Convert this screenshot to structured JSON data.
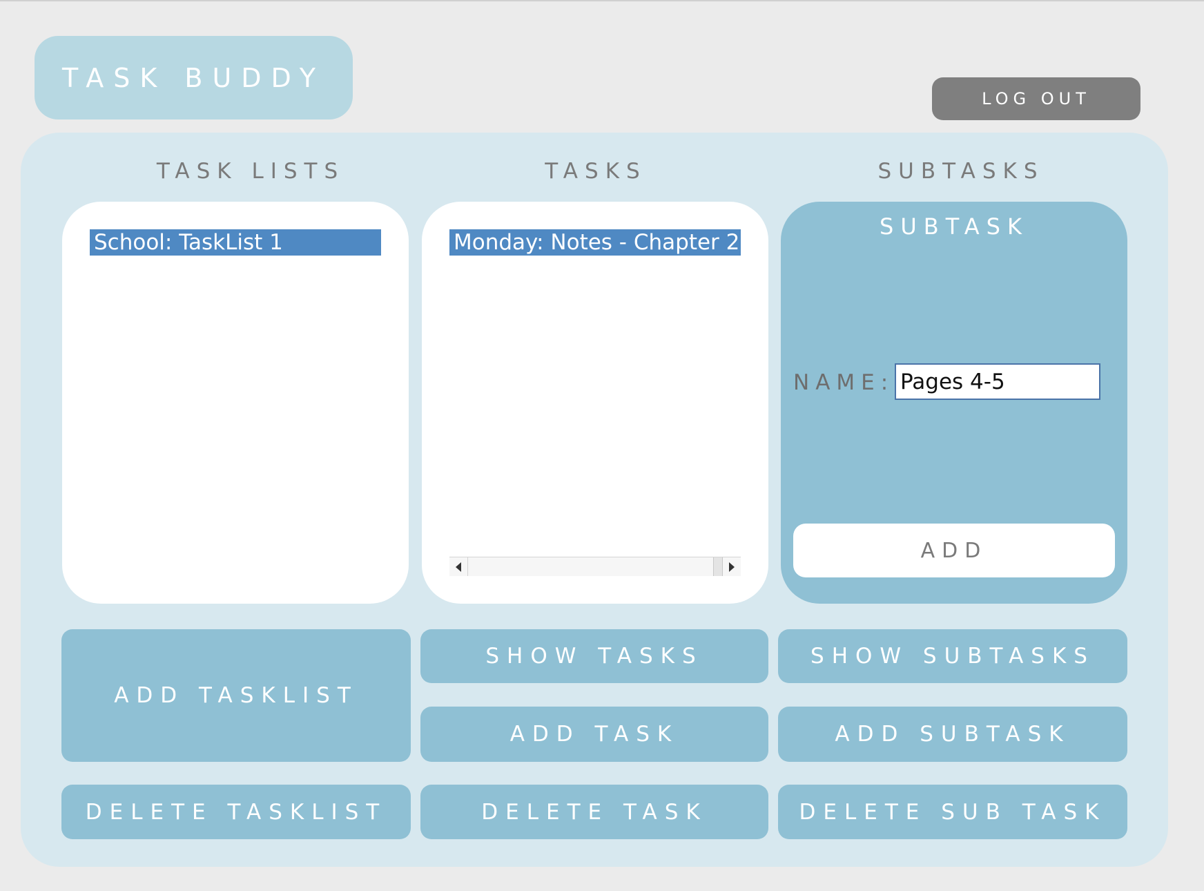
{
  "app": {
    "title": "TASK BUDDY",
    "logout_label": "LOG OUT"
  },
  "columns": {
    "tasklists_title": "TASK LISTS",
    "tasks_title": "TASKS",
    "subtasks_title": "SUBTASKS"
  },
  "tasklists": {
    "items": [
      {
        "label": "School: TaskList 1",
        "selected": true
      }
    ]
  },
  "tasks": {
    "items": [
      {
        "label": "Monday: Notes - Chapter 2",
        "selected": true
      }
    ]
  },
  "subtask_form": {
    "heading": "SUBTASK",
    "name_label": "NAME:",
    "name_value": "Pages 4-5",
    "add_label": "ADD"
  },
  "actions": {
    "add_tasklist": "ADD TASKLIST",
    "show_tasks": "SHOW TASKS",
    "add_task": "ADD TASK",
    "show_subtasks": "SHOW SUBTASKS",
    "add_subtask": "ADD SUBTASK",
    "delete_tasklist": "DELETE TASKLIST",
    "delete_task": "DELETE TASK",
    "delete_subtask": "DELETE SUB TASK"
  },
  "colors": {
    "background": "#ebebeb",
    "panel": "#d7e8ef",
    "logo": "#b7d8e2",
    "button": "#8fc0d4",
    "selection": "#4f89c3",
    "logout": "#7f7f7f"
  }
}
